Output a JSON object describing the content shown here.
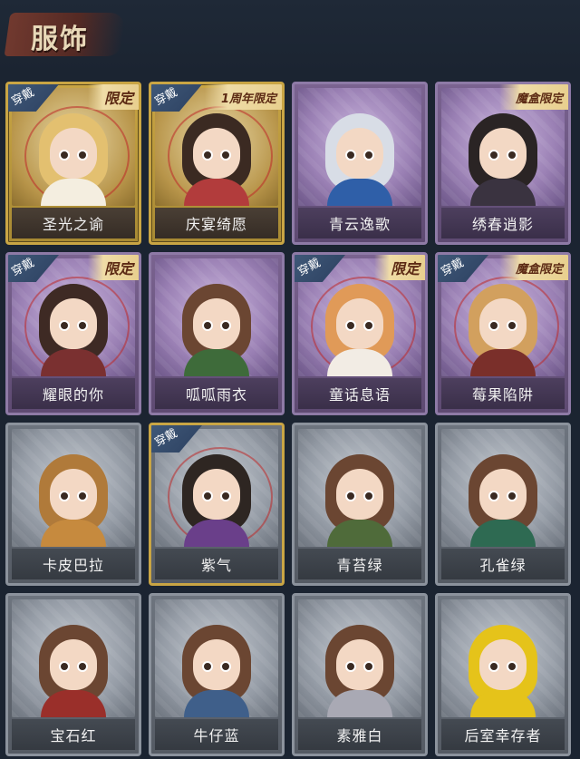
{
  "header": {
    "title": "服饰"
  },
  "cards": [
    {
      "name": "圣光之谕",
      "frame": "gold",
      "equipped": "穿戴",
      "tag": "限定",
      "hair": "#e3c070",
      "body": "#f4eee0",
      "ring": true
    },
    {
      "name": "庆宴绮愿",
      "frame": "gold",
      "equipped": "穿戴",
      "tag": "1周年限定",
      "hair": "#3b2a22",
      "body": "#b23c3c",
      "ring": true
    },
    {
      "name": "青云逸歌",
      "frame": "purple",
      "equipped": "",
      "tag": "",
      "hair": "#d8dde6",
      "body": "#2f5fa8",
      "ring": false
    },
    {
      "name": "绣春逍影",
      "frame": "purple",
      "equipped": "",
      "tag": "魔盒限定",
      "hair": "#2a2424",
      "body": "#3a3340",
      "ring": false
    },
    {
      "name": "耀眼的你",
      "frame": "purple",
      "equipped": "穿戴",
      "tag": "限定",
      "hair": "#3e2a24",
      "body": "#7a3030",
      "ring": true
    },
    {
      "name": "呱呱雨衣",
      "frame": "purple",
      "equipped": "",
      "tag": "",
      "hair": "#6b4632",
      "body": "#3e6b3a",
      "ring": false
    },
    {
      "name": "童话息语",
      "frame": "purple",
      "equipped": "穿戴",
      "tag": "限定",
      "hair": "#e09a58",
      "body": "#f2ece4",
      "ring": true
    },
    {
      "name": "莓果陷阱",
      "frame": "purple",
      "equipped": "穿戴",
      "tag": "魔盒限定",
      "hair": "#d2a05e",
      "body": "#7a2f2a",
      "ring": true
    },
    {
      "name": "卡皮巴拉",
      "frame": "gray",
      "equipped": "",
      "tag": "",
      "hair": "#b07a3a",
      "body": "#c68a3e",
      "ring": false
    },
    {
      "name": "紫气",
      "frame": "gray",
      "equipped": "穿戴",
      "tag": "",
      "hair": "#2e2622",
      "body": "#6a3f8a",
      "ring": true,
      "gold_border": true
    },
    {
      "name": "青苔绿",
      "frame": "gray",
      "equipped": "",
      "tag": "",
      "hair": "#6b4632",
      "body": "#4f6b3a",
      "ring": false
    },
    {
      "name": "孔雀绿",
      "frame": "gray",
      "equipped": "",
      "tag": "",
      "hair": "#6b4632",
      "body": "#2e6a52",
      "ring": false
    },
    {
      "name": "宝石红",
      "frame": "gray",
      "equipped": "",
      "tag": "",
      "hair": "#6b4632",
      "body": "#9a2f2a",
      "ring": false
    },
    {
      "name": "牛仔蓝",
      "frame": "gray",
      "equipped": "",
      "tag": "",
      "hair": "#6b4632",
      "body": "#3f5f8a",
      "ring": false
    },
    {
      "name": "素雅白",
      "frame": "gray",
      "equipped": "",
      "tag": "",
      "hair": "#6b4632",
      "body": "#a9a9b4",
      "ring": false
    },
    {
      "name": "后室幸存者",
      "frame": "gray",
      "equipped": "",
      "tag": "",
      "hair": "#e5c31a",
      "body": "#e5c31a",
      "ring": false
    }
  ]
}
